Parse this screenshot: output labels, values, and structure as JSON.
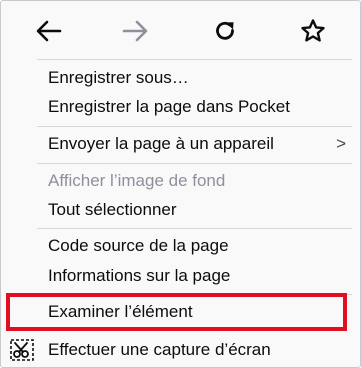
{
  "toolbar": {
    "buttons": [
      {
        "name": "back",
        "icon": "arrow-left-icon"
      },
      {
        "name": "forward",
        "icon": "arrow-right-icon",
        "disabled": true
      },
      {
        "name": "reload",
        "icon": "reload-icon"
      },
      {
        "name": "bookmark",
        "icon": "star-icon"
      }
    ]
  },
  "menu": {
    "items": {
      "save_as": "Enregistrer sous…",
      "save_pocket": "Enregistrer la page dans Pocket",
      "send_to_device": "Envoyer la page à un appareil",
      "send_to_device_chevron": ">",
      "view_background": "Afficher l’image de fond",
      "select_all": "Tout sélectionner",
      "view_source": "Code source de la page",
      "page_info": "Informations sur la page",
      "inspect": "Examiner l’élément",
      "screenshot": "Effectuer une capture d’écran"
    },
    "screenshot_icon": "scissors-icon"
  },
  "colors": {
    "highlight": "#e01020",
    "disabled_text": "#8f8f9d",
    "text": "#0c0c0d"
  }
}
